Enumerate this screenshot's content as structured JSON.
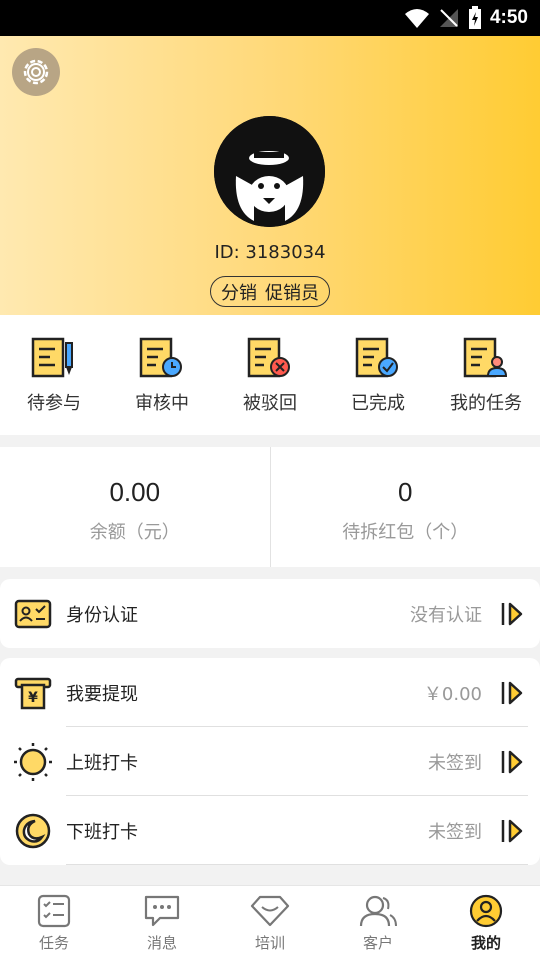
{
  "status_bar": {
    "time": "4:50"
  },
  "profile": {
    "id_text": "ID: 3183034",
    "roles": [
      "分销",
      "促销员"
    ]
  },
  "tasks": [
    {
      "label": "待参与",
      "icon": "task-pending-icon"
    },
    {
      "label": "审核中",
      "icon": "task-reviewing-icon"
    },
    {
      "label": "被驳回",
      "icon": "task-rejected-icon"
    },
    {
      "label": "已完成",
      "icon": "task-completed-icon"
    },
    {
      "label": "我的任务",
      "icon": "my-task-icon"
    }
  ],
  "stats": {
    "balance": {
      "value": "0.00",
      "label": "余额（元）"
    },
    "red_packets": {
      "value": "0",
      "label": "待拆红包（个）"
    }
  },
  "menu": {
    "identity": {
      "label": "身份认证",
      "value": "没有认证",
      "icon": "id-card-icon"
    },
    "withdraw": {
      "label": "我要提现",
      "value": "￥0.00",
      "icon": "withdraw-icon"
    },
    "clock_in": {
      "label": "上班打卡",
      "value": "未签到",
      "icon": "sun-icon"
    },
    "clock_out": {
      "label": "下班打卡",
      "value": "未签到",
      "icon": "moon-icon"
    }
  },
  "bottom_nav": [
    {
      "label": "任务",
      "icon": "task-list-icon",
      "active": false
    },
    {
      "label": "消息",
      "icon": "message-icon",
      "active": false
    },
    {
      "label": "培训",
      "icon": "training-icon",
      "active": false
    },
    {
      "label": "客户",
      "icon": "customers-icon",
      "active": false
    },
    {
      "label": "我的",
      "icon": "profile-icon",
      "active": true
    }
  ],
  "colors": {
    "accent": "#ffcc33",
    "header_start": "#ffe9b0",
    "header_end": "#ffcc33",
    "icon_fill": "#ffd966"
  }
}
